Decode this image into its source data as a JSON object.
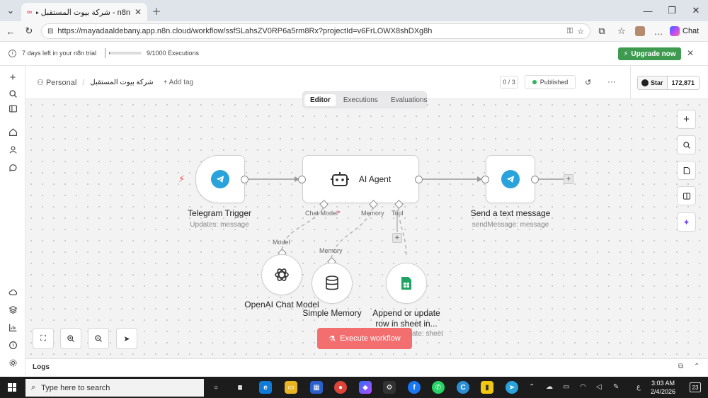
{
  "browser": {
    "tab_title": "n8n - شركة بيوت المستقبل ▶",
    "tab_favicon": "n8n",
    "url": "https://mayadaaldebany.app.n8n.cloud/workflow/ssfSLahsZV0RP6a5rm8Rx?projectId=v6FrLOWX8shDXg8h",
    "chat_label": "Chat"
  },
  "trial": {
    "days_left_text": "7 days left in your n8n trial",
    "executions_text": "9/1000 Executions",
    "executions_fraction": 0.009,
    "upgrade_label": "Upgrade now"
  },
  "header": {
    "project": "Personal",
    "workflow_name": "شركة بيوت المستقبل",
    "add_tag": "+ Add tag",
    "counter": "0 / 3",
    "published_label": "Published",
    "star_label": "Star",
    "star_count": "172,871"
  },
  "tabs": [
    {
      "label": "Editor",
      "active": true
    },
    {
      "label": "Executions",
      "active": false
    },
    {
      "label": "Evaluations",
      "active": false
    }
  ],
  "nodes": {
    "trigger": {
      "title": "Telegram Trigger",
      "subtitle": "Updates: message"
    },
    "agent": {
      "title": "AI Agent",
      "chat_model_label": "Chat Model",
      "required_mark": "*",
      "memory_label": "Memory",
      "tool_label": "Tool"
    },
    "send": {
      "title": "Send a text message",
      "subtitle": "sendMessage: message"
    },
    "openai": {
      "title": "OpenAI Chat Model",
      "conn_label": "Model"
    },
    "memory": {
      "title": "Simple Memory",
      "conn_label": "Memory"
    },
    "sheets": {
      "title_line1": "Append or update",
      "title_line2": "row in sheet in...",
      "subtitle_partial": "ate: sheet"
    }
  },
  "execute_label": "Execute workflow",
  "logs_label": "Logs",
  "taskbar": {
    "search_placeholder": "Type here to search",
    "time": "3:03 AM",
    "date": "2/4/2026",
    "lang": "ع",
    "notif_count": "23"
  },
  "colors": {
    "upgrade": "#3d9a4f",
    "execute": "#f36f6f",
    "telegram": "#2aa3dd",
    "published_dot": "#2fb35b",
    "trigger_bolt": "#ea4b4b"
  }
}
